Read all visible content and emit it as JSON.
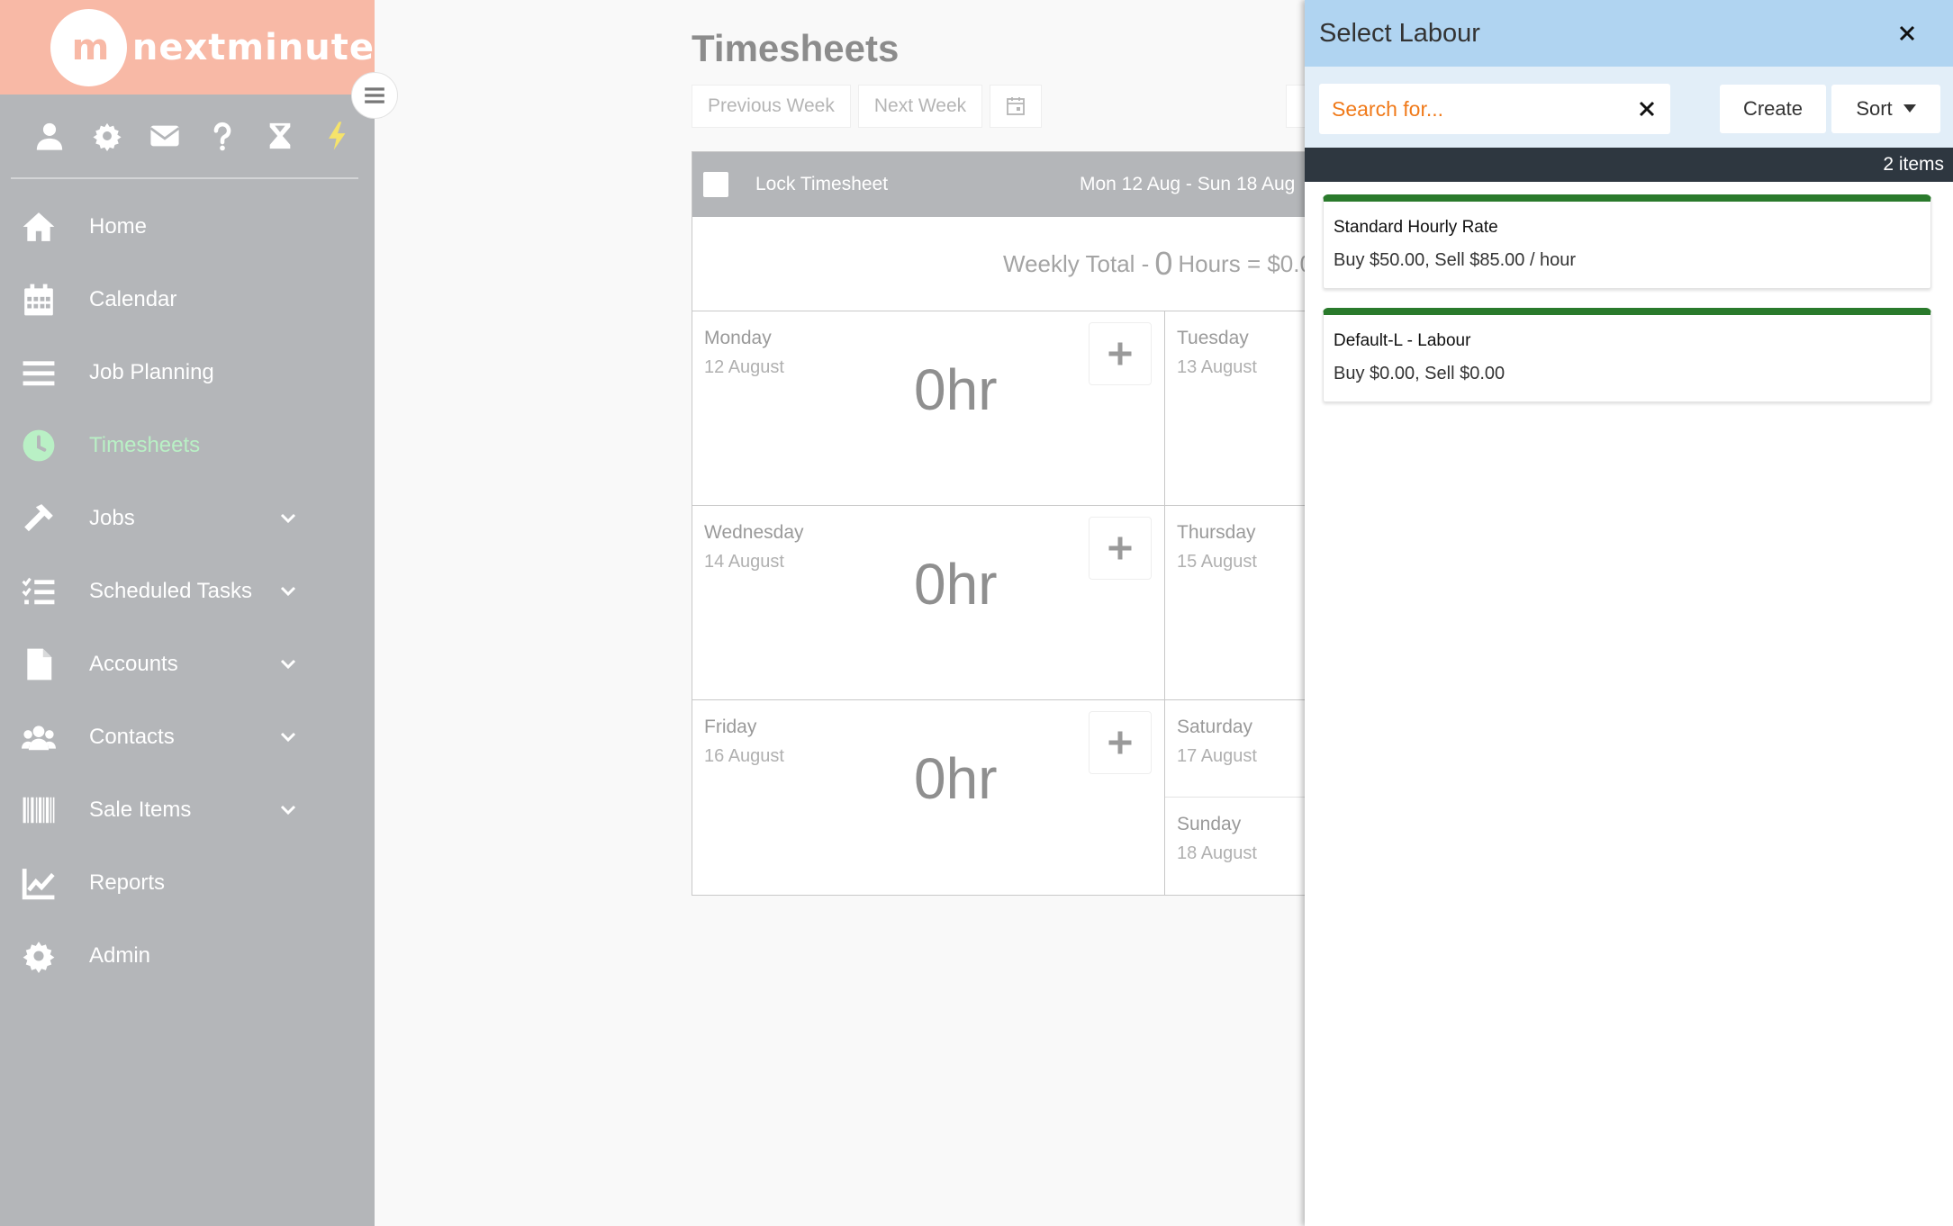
{
  "brand": {
    "logo_mark": "m",
    "name": "nextminute"
  },
  "colors": {
    "brand_salmon": "#f8b9a6",
    "sidebar_bg": "#b4b6b9",
    "active_nav": "#b9f0c5",
    "panel_header": "#b0d4f1",
    "search_placeholder": "#f07a1a",
    "item_accent": "#2a7a2c",
    "count_bar": "#2e3740"
  },
  "top_icons": [
    "user-icon",
    "gear-icon",
    "mail-icon",
    "question-icon",
    "hourglass-icon",
    "lightning-icon"
  ],
  "nav": {
    "items": [
      {
        "label": "Home",
        "icon": "home-icon",
        "expandable": false,
        "active": false
      },
      {
        "label": "Calendar",
        "icon": "calendar-icon",
        "expandable": false,
        "active": false
      },
      {
        "label": "Job Planning",
        "icon": "list-icon",
        "expandable": false,
        "active": false
      },
      {
        "label": "Timesheets",
        "icon": "clock-icon",
        "expandable": false,
        "active": true
      },
      {
        "label": "Jobs",
        "icon": "hammer-icon",
        "expandable": true,
        "active": false
      },
      {
        "label": "Scheduled Tasks",
        "icon": "task-list-icon",
        "expandable": true,
        "active": false
      },
      {
        "label": "Accounts",
        "icon": "file-icon",
        "expandable": true,
        "active": false
      },
      {
        "label": "Contacts",
        "icon": "users-icon",
        "expandable": true,
        "active": false
      },
      {
        "label": "Sale Items",
        "icon": "barcode-icon",
        "expandable": true,
        "active": false
      },
      {
        "label": "Reports",
        "icon": "chart-line-icon",
        "expandable": false,
        "active": false
      },
      {
        "label": "Admin",
        "icon": "gear-icon",
        "expandable": false,
        "active": false
      }
    ]
  },
  "main": {
    "title": "Timesheets",
    "toolbar": {
      "previous_week": "Previous Week",
      "next_week": "Next Week"
    },
    "sheet": {
      "lock_label": "Lock Timesheet",
      "week_range": "Mon 12 Aug - Sun 18 Aug",
      "weekly_total_prefix": "Weekly Total -",
      "weekly_total_hours": "0",
      "weekly_total_suffix": "Hours = $0.0",
      "days": {
        "monday": {
          "name": "Monday",
          "date": "12 August",
          "hours": "0hr"
        },
        "tuesday": {
          "name": "Tuesday",
          "date": "13 August"
        },
        "wednesday": {
          "name": "Wednesday",
          "date": "14 August",
          "hours": "0hr"
        },
        "thursday": {
          "name": "Thursday",
          "date": "15 August"
        },
        "friday": {
          "name": "Friday",
          "date": "16 August",
          "hours": "0hr"
        },
        "saturday": {
          "name": "Saturday",
          "date": "17 August"
        },
        "sunday": {
          "name": "Sunday",
          "date": "18 August"
        }
      }
    }
  },
  "panel": {
    "title": "Select Labour",
    "search": {
      "placeholder": "Search for...",
      "value": ""
    },
    "create_label": "Create",
    "sort_label": "Sort",
    "count_label": "2 items",
    "items": [
      {
        "name": "Standard Hourly Rate",
        "desc": "Buy $50.00, Sell $85.00 / hour"
      },
      {
        "name": "Default-L - Labour",
        "desc": "Buy $0.00, Sell $0.00"
      }
    ]
  }
}
